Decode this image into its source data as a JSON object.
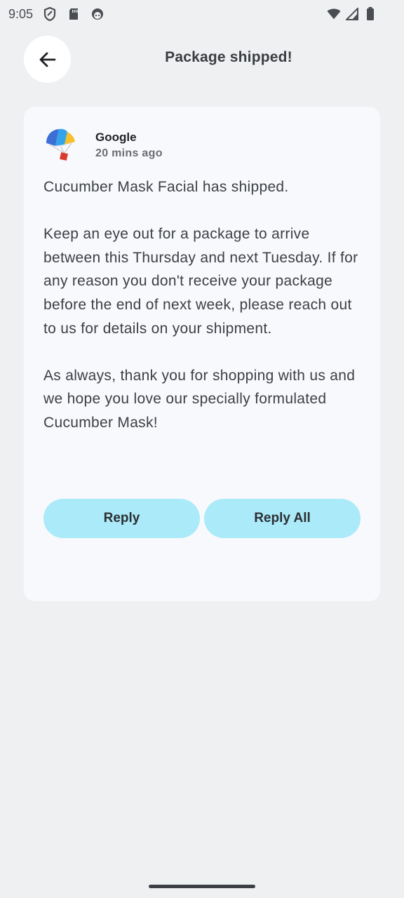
{
  "status_bar": {
    "time": "9:05",
    "left_icons": [
      "shield-icon",
      "sd-card-icon",
      "android-face-icon"
    ],
    "right_icons": [
      "wifi-icon",
      "signal-icon",
      "battery-icon"
    ]
  },
  "header": {
    "back_icon": "arrow-left-icon",
    "title": "Package shipped!"
  },
  "email": {
    "sender": "Google",
    "time_ago": "20 mins ago",
    "avatar_icon": "parachute-package-icon",
    "paragraphs": [
      "Cucumber Mask Facial has shipped.",
      "Keep an eye out for a package to arrive between this Thursday and next Tuesday. If for any reason you don't receive your package before the end of next week, please reach out to us for details on your shipment.",
      "As always, thank you for shopping with us and we hope you love our specially formulated Cucumber Mask!"
    ],
    "actions": {
      "reply": "Reply",
      "reply_all": "Reply All"
    }
  },
  "colors": {
    "background": "#eff0f2",
    "card": "#f8f9fc",
    "button": "#abeaf9"
  }
}
